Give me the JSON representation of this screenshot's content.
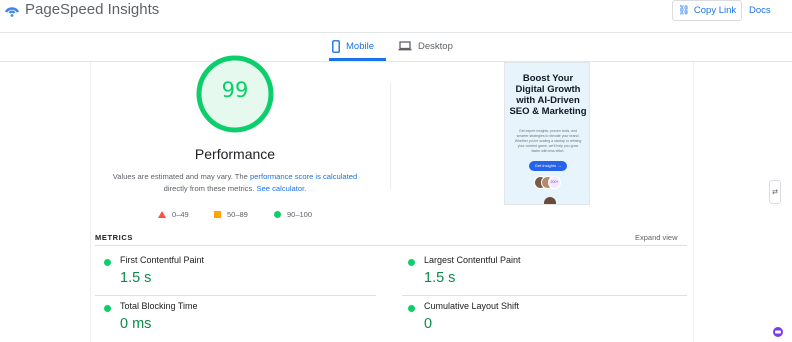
{
  "app": {
    "title": "PageSpeed Insights",
    "copy_link_label": "Copy Link",
    "docs_label": "Docs"
  },
  "tabs": [
    {
      "label": "Mobile",
      "active": true,
      "icon": "smartphone-icon"
    },
    {
      "label": "Desktop",
      "active": false,
      "icon": "laptop-icon"
    }
  ],
  "score": {
    "value": "99",
    "value_fraction": 0.99,
    "category": "Performance",
    "note_prefix": "Values are estimated and may vary. The ",
    "note_link1": "performance score is calculated",
    "note_middle": " directly from these metrics. ",
    "note_link2": "See calculator",
    "note_suffix": "."
  },
  "legend": [
    {
      "range": "0–49",
      "shape": "triangle",
      "color": "#ff4e42"
    },
    {
      "range": "50–89",
      "shape": "square",
      "color": "#ffa400"
    },
    {
      "range": "90–100",
      "shape": "circle",
      "color": "#0cce6b"
    }
  ],
  "screenshot": {
    "headline": "Boost Your Digital Growth with AI-Driven SEO & Marketing",
    "body": "Get expert insights, proven tools, and smarter strategies to elevate your brand. Whether you're scaling a startup or refining your content game, we'll help you grow faster with less effort.",
    "button": "Get Insights →",
    "badge": "200+"
  },
  "metrics": {
    "section_label": "METRICS",
    "expand_label": "Expand view",
    "items": [
      {
        "name": "First Contentful Paint",
        "value": "1.5 s",
        "status": "pass"
      },
      {
        "name": "Largest Contentful Paint",
        "value": "1.5 s",
        "status": "pass"
      },
      {
        "name": "Total Blocking Time",
        "value": "0 ms",
        "status": "pass"
      },
      {
        "name": "Cumulative Layout Shift",
        "value": "0",
        "status": "pass"
      }
    ]
  },
  "colors": {
    "accent": "#1a73e8",
    "pass": "#0cce6b",
    "pass_text": "#0c8a4a",
    "average": "#ffa400",
    "fail": "#ff4e42"
  }
}
